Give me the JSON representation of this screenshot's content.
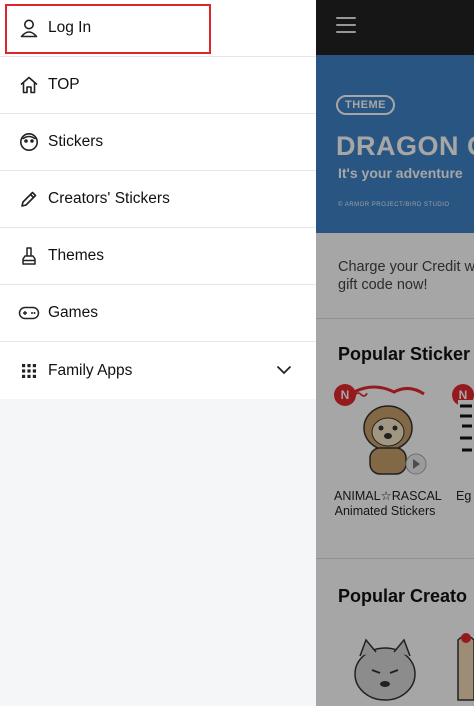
{
  "drawer": {
    "menu": [
      {
        "id": "login",
        "label": "Log In",
        "icon": "user-icon"
      },
      {
        "id": "top",
        "label": "TOP",
        "icon": "home-icon"
      },
      {
        "id": "stickers",
        "label": "Stickers",
        "icon": "sticker-face-icon"
      },
      {
        "id": "creators-stickers",
        "label": "Creators' Stickers",
        "icon": "pencil-icon"
      },
      {
        "id": "themes",
        "label": "Themes",
        "icon": "brush-icon"
      },
      {
        "id": "games",
        "label": "Games",
        "icon": "gamepad-icon"
      },
      {
        "id": "family-apps",
        "label": "Family Apps",
        "icon": "grid-icon",
        "expand_icon": "chevron-down-icon"
      }
    ],
    "highlight_color": "#e0242a"
  },
  "background": {
    "theme_banner": {
      "badge": "THEME",
      "title": "DRAGON Q",
      "subtitle": "It's your adventure",
      "copyright": "© ARMOR PROJECT/BIRD STUDIO",
      "color": "#3f83c8"
    },
    "charge_text": [
      "Charge your Credit w",
      "gift code now!"
    ],
    "popular_stickers": {
      "title": "Popular Sticker",
      "new_badge": "N",
      "items": [
        {
          "name": "ANIMAL☆RASCAL Animated Stickers"
        },
        {
          "name": "Eg Tw"
        }
      ]
    },
    "popular_creators": {
      "title": "Popular Creato"
    }
  }
}
